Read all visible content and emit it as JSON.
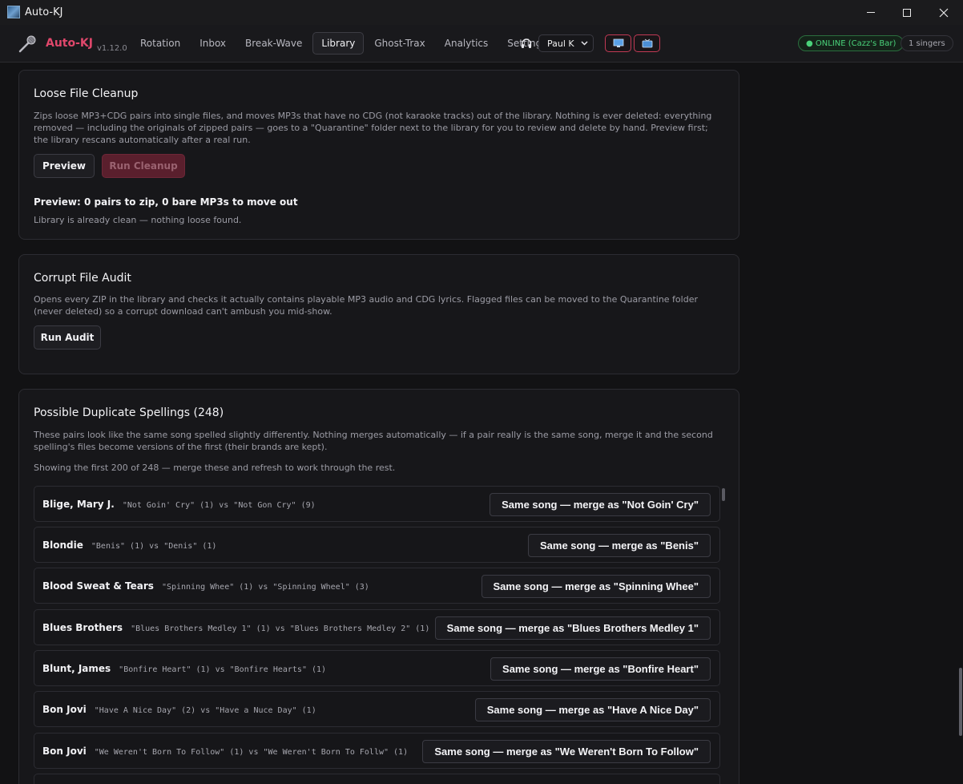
{
  "window": {
    "title": "Auto-KJ",
    "icon": "app-icon",
    "controls": [
      "minimize-icon",
      "maximize-icon",
      "close-icon"
    ]
  },
  "header": {
    "brand": "Auto-KJ",
    "version": "v1.12.0",
    "nav": [
      {
        "label": "Rotation",
        "active": false
      },
      {
        "label": "Inbox",
        "active": false
      },
      {
        "label": "Break-Wave",
        "active": false
      },
      {
        "label": "Library",
        "active": true
      },
      {
        "label": "Ghost-Trax",
        "active": false
      },
      {
        "label": "Analytics",
        "active": false
      },
      {
        "label": "Settings",
        "active": false
      }
    ],
    "user": "Paul K",
    "status": "● ONLINE (Cazz's Bar)",
    "singers": "1 singers"
  },
  "cleanup": {
    "title": "Loose File Cleanup",
    "description": "Zips loose MP3+CDG pairs into single files, and moves MP3s that have no CDG (not karaoke tracks) out of the library. Nothing is ever deleted: everything removed — including the originals of zipped pairs — goes to a \"Quarantine\" folder next to the library for you to review and delete by hand. Preview first; the library rescans automatically after a real run.",
    "preview_label": "Preview",
    "run_label": "Run Cleanup",
    "result": "Preview: 0 pairs to zip, 0 bare MP3s to move out",
    "note": "Library is already clean — nothing loose found."
  },
  "audit": {
    "title": "Corrupt File Audit",
    "description": "Opens every ZIP in the library and checks it actually contains playable MP3 audio and CDG lyrics. Flagged files can be moved to the Quarantine folder (never deleted) so a corrupt download can't ambush you mid-show.",
    "run_label": "Run Audit"
  },
  "duplicates": {
    "title": "Possible Duplicate Spellings (248)",
    "description": "These pairs look like the same song spelled slightly differently. Nothing merges automatically — if a pair really is the same song, merge it and the second spelling's files become versions of the first (their brands are kept).",
    "showing": "Showing the first 200 of 248 — merge these and refresh to work through the rest.",
    "rows": [
      {
        "artist": "Blige, Mary J.",
        "detail": "\"Not Goin' Cry\" (1) vs \"Not Gon Cry\" (9)",
        "merge": "Same song — merge as \"Not Goin' Cry\""
      },
      {
        "artist": "Blondie",
        "detail": "\"Benis\" (1) vs \"Denis\" (1)",
        "merge": "Same song — merge as \"Benis\""
      },
      {
        "artist": "Blood Sweat & Tears",
        "detail": "\"Spinning Whee\" (1) vs \"Spinning Wheel\" (3)",
        "merge": "Same song — merge as \"Spinning Whee\""
      },
      {
        "artist": "Blues Brothers",
        "detail": "\"Blues Brothers Medley 1\" (1) vs \"Blues Brothers Medley 2\" (1)",
        "merge": "Same song — merge as \"Blues Brothers Medley 1\""
      },
      {
        "artist": "Blunt, James",
        "detail": "\"Bonfire Heart\" (1) vs \"Bonfire Hearts\" (1)",
        "merge": "Same song — merge as \"Bonfire Heart\""
      },
      {
        "artist": "Bon Jovi",
        "detail": "\"Have A Nice Day\" (2) vs \"Have a Nuce Day\" (1)",
        "merge": "Same song — merge as \"Have A Nice Day\""
      },
      {
        "artist": "Bon Jovi",
        "detail": "\"We Weren't Born To Follow\" (1) vs \"We Weren't Born To Follw\" (1)",
        "merge": "Same song — merge as \"We Weren't Born To Follow\""
      }
    ]
  },
  "colors": {
    "accent": "#e0476b",
    "online": "#4ad27a",
    "background": "#121214",
    "card": "#17171a"
  }
}
